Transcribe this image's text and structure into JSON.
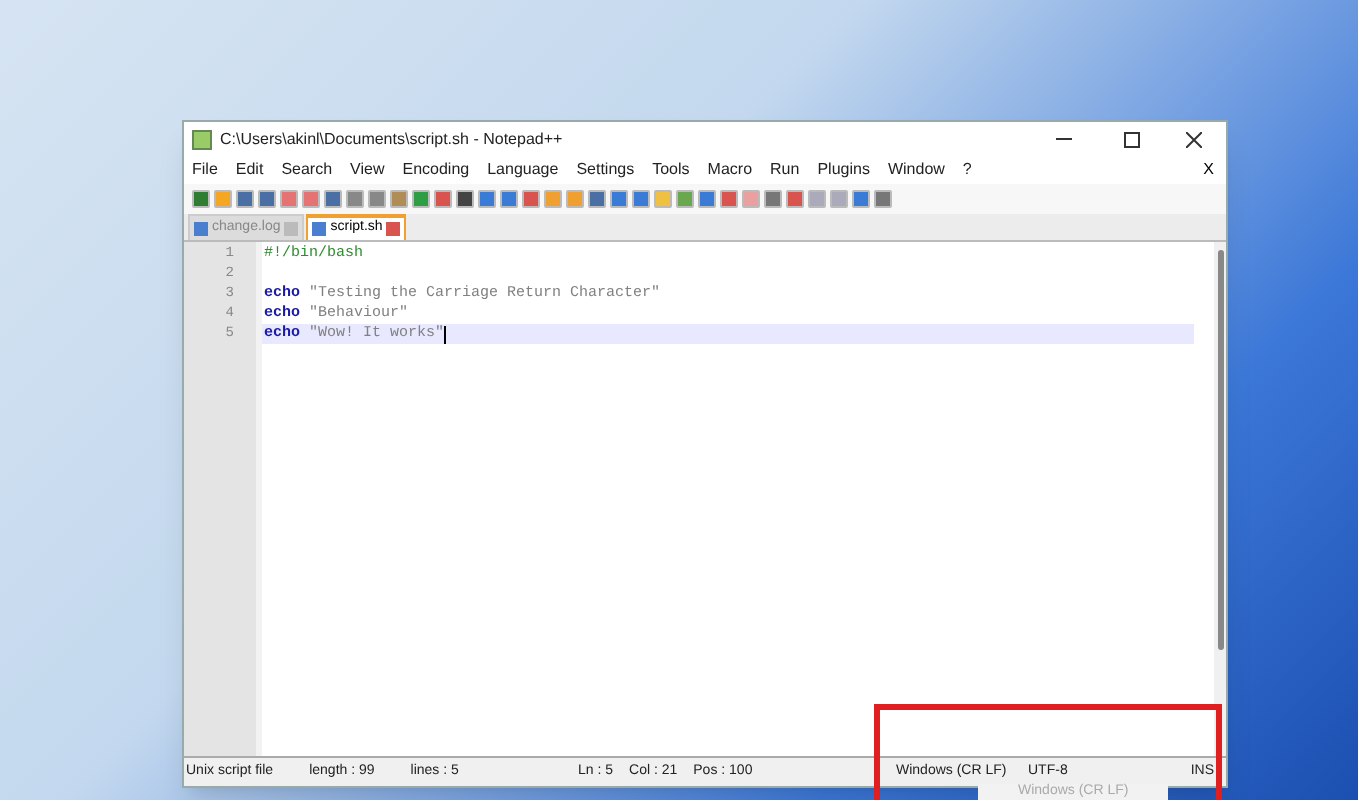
{
  "window": {
    "title": "C:\\Users\\akinl\\Documents\\script.sh - Notepad++",
    "close_doc": "X"
  },
  "menu": [
    "File",
    "Edit",
    "Search",
    "View",
    "Encoding",
    "Language",
    "Settings",
    "Tools",
    "Macro",
    "Run",
    "Plugins",
    "Window",
    "?"
  ],
  "tabs": [
    {
      "label": "change.log",
      "selected": false
    },
    {
      "label": "script.sh",
      "selected": true
    }
  ],
  "editor": {
    "lines": [
      {
        "number": "1",
        "current": false,
        "tokens": [
          {
            "kind": "comment",
            "text": "#!/bin/bash"
          }
        ]
      },
      {
        "number": "2",
        "current": false
      },
      {
        "number": "3",
        "current": false,
        "tokens": [
          {
            "kind": "keyword",
            "text": "echo"
          },
          {
            "kind": "string",
            "text": " \"Testing the Carriage Return Character\""
          }
        ]
      },
      {
        "number": "4",
        "current": false,
        "tokens": [
          {
            "kind": "keyword",
            "text": "echo"
          },
          {
            "kind": "string",
            "text": " \"Behaviour\""
          }
        ]
      },
      {
        "number": "5",
        "current": true,
        "tokens": [
          {
            "kind": "keyword",
            "text": "echo"
          },
          {
            "kind": "string",
            "text": " \"Wow! It works\""
          }
        ]
      }
    ]
  },
  "status_bar": {
    "left": [
      "Unix script file",
      "length : 99",
      "lines : 5"
    ],
    "middle": [
      "Ln : 5",
      "Col : 21",
      "Pos : 100"
    ],
    "right": [
      "Windows (CR LF)",
      "UTF-8",
      "INS"
    ]
  },
  "popup_menu": [
    {
      "label": "Windows (CR LF)",
      "disabled": true
    }
  ]
}
